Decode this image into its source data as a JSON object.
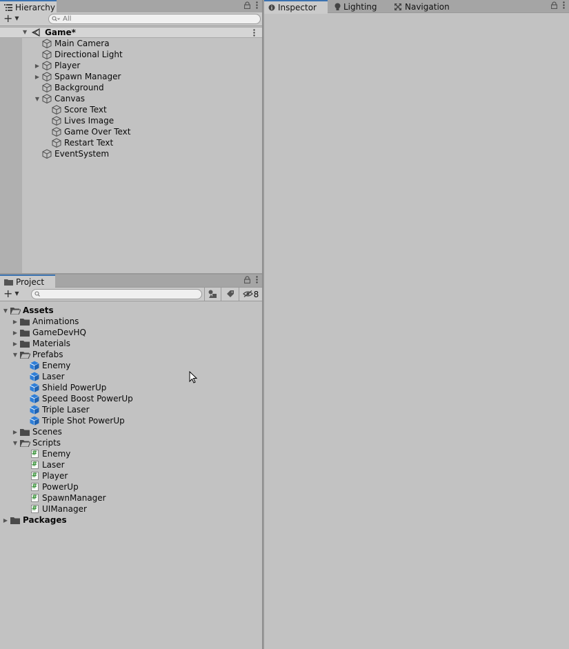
{
  "hierarchy": {
    "tab_label": "Hierarchy",
    "search_placeholder": "All",
    "scene_name": "Game*",
    "items": [
      {
        "label": "Main Camera",
        "depth": 1,
        "fold": "none"
      },
      {
        "label": "Directional Light",
        "depth": 1,
        "fold": "none"
      },
      {
        "label": "Player",
        "depth": 1,
        "fold": "collapsed"
      },
      {
        "label": "Spawn Manager",
        "depth": 1,
        "fold": "collapsed"
      },
      {
        "label": "Background",
        "depth": 1,
        "fold": "none"
      },
      {
        "label": "Canvas",
        "depth": 1,
        "fold": "expanded"
      },
      {
        "label": "Score Text",
        "depth": 2,
        "fold": "none"
      },
      {
        "label": "Lives Image",
        "depth": 2,
        "fold": "none"
      },
      {
        "label": "Game Over Text",
        "depth": 2,
        "fold": "none"
      },
      {
        "label": "Restart Text",
        "depth": 2,
        "fold": "none"
      },
      {
        "label": "EventSystem",
        "depth": 1,
        "fold": "none"
      }
    ]
  },
  "project": {
    "tab_label": "Project",
    "hidden_count": "8",
    "tree": [
      {
        "label": "Assets",
        "depth": 0,
        "fold": "expanded",
        "type": "folder-open",
        "bold": true
      },
      {
        "label": "Animations",
        "depth": 1,
        "fold": "collapsed",
        "type": "folder"
      },
      {
        "label": "GameDevHQ",
        "depth": 1,
        "fold": "collapsed",
        "type": "folder"
      },
      {
        "label": "Materials",
        "depth": 1,
        "fold": "collapsed",
        "type": "folder"
      },
      {
        "label": "Prefabs",
        "depth": 1,
        "fold": "expanded",
        "type": "folder-open"
      },
      {
        "label": "Enemy",
        "depth": 2,
        "fold": "none",
        "type": "prefab"
      },
      {
        "label": "Laser",
        "depth": 2,
        "fold": "none",
        "type": "prefab"
      },
      {
        "label": "Shield PowerUp",
        "depth": 2,
        "fold": "none",
        "type": "prefab"
      },
      {
        "label": "Speed Boost PowerUp",
        "depth": 2,
        "fold": "none",
        "type": "prefab"
      },
      {
        "label": "Triple Laser",
        "depth": 2,
        "fold": "none",
        "type": "prefab"
      },
      {
        "label": "Triple Shot PowerUp",
        "depth": 2,
        "fold": "none",
        "type": "prefab"
      },
      {
        "label": "Scenes",
        "depth": 1,
        "fold": "collapsed",
        "type": "folder"
      },
      {
        "label": "Scripts",
        "depth": 1,
        "fold": "expanded",
        "type": "folder-open"
      },
      {
        "label": "Enemy",
        "depth": 2,
        "fold": "none",
        "type": "script"
      },
      {
        "label": "Laser",
        "depth": 2,
        "fold": "none",
        "type": "script"
      },
      {
        "label": "Player",
        "depth": 2,
        "fold": "none",
        "type": "script"
      },
      {
        "label": "PowerUp",
        "depth": 2,
        "fold": "none",
        "type": "script"
      },
      {
        "label": "SpawnManager",
        "depth": 2,
        "fold": "none",
        "type": "script"
      },
      {
        "label": "UIManager",
        "depth": 2,
        "fold": "none",
        "type": "script"
      },
      {
        "label": "Packages",
        "depth": 0,
        "fold": "collapsed",
        "type": "folder",
        "bold": true
      }
    ]
  },
  "right": {
    "tabs": [
      {
        "label": "Inspector",
        "icon": "info-icon",
        "active": true
      },
      {
        "label": "Lighting",
        "icon": "lightbulb-icon",
        "active": false
      },
      {
        "label": "Navigation",
        "icon": "navigation-icon",
        "active": false
      }
    ]
  },
  "colors": {
    "panel_bg": "#c2c2c2",
    "tab_active_accent": "#3a72b0",
    "prefab_blue": "#2f7fd8",
    "script_hash": "#2b8a2b"
  }
}
